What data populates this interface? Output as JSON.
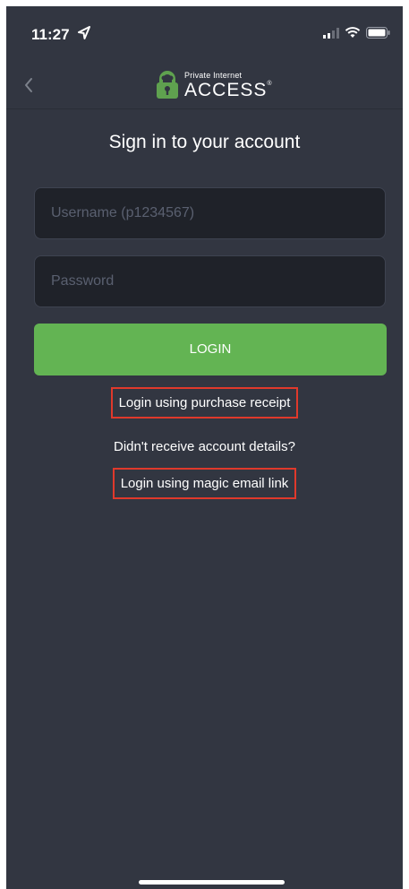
{
  "status_bar": {
    "time": "11:27"
  },
  "header": {
    "brand_small": "Private Internet",
    "brand_big": "ACCESS",
    "brand_reg": "®"
  },
  "form": {
    "title": "Sign in to your account",
    "username_placeholder": "Username (p1234567)",
    "password_placeholder": "Password",
    "login_label": "LOGIN"
  },
  "links": {
    "purchase_receipt": "Login using purchase receipt",
    "no_account_details": "Didn't receive account details?",
    "magic_email": "Login using magic email link"
  },
  "colors": {
    "background": "#323641",
    "login_button": "#63b453",
    "highlight_box": "#e0392b"
  },
  "icons": [
    "location-arrow-icon",
    "signal-icon",
    "wifi-icon",
    "battery-icon",
    "back-chevron-icon",
    "lock-logo-icon"
  ]
}
